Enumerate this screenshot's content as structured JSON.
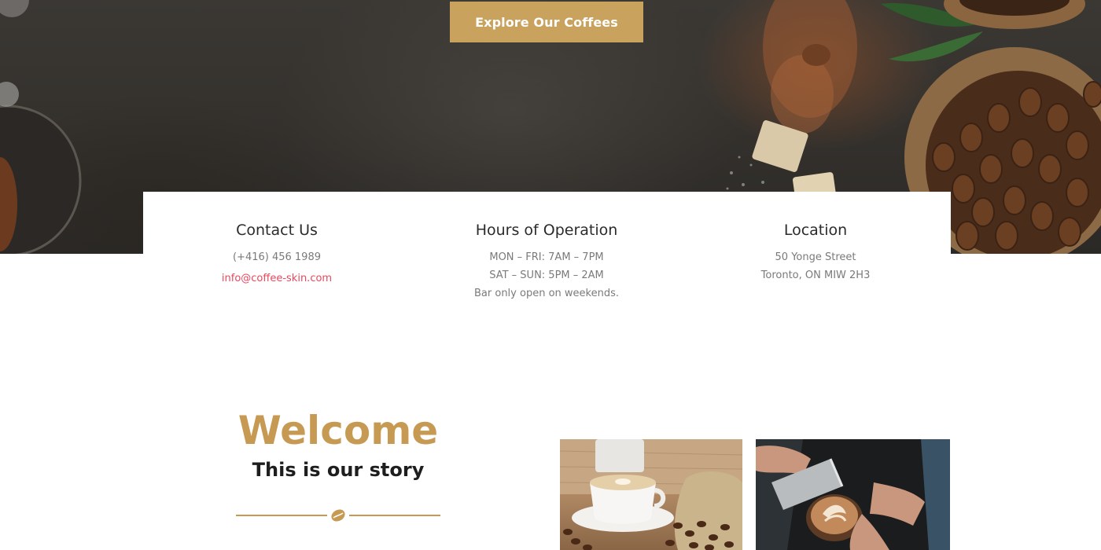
{
  "hero": {
    "cta_label": "Explore Our Coffees"
  },
  "info": {
    "contact": {
      "title": "Contact Us",
      "phone": "(+416) 456 1989",
      "email": "info@coffee-skin.com"
    },
    "hours": {
      "title": "Hours of Operation",
      "line1": "MON – FRI: 7AM – 7PM",
      "line2": "SAT – SUN: 5PM – 2AM",
      "line3": "Bar only open on weekends."
    },
    "location": {
      "title": "Location",
      "line1": "50 Yonge Street",
      "line2": "Toronto, ON MIW 2H3"
    }
  },
  "welcome": {
    "title": "Welcome",
    "subtitle": "This is our story"
  },
  "icons": {
    "divider": "coffee-bean-icon"
  },
  "colors": {
    "accent": "#c9a25e",
    "link": "#e8475c",
    "heading": "#2b2b2b",
    "muted": "#7a7a7a"
  }
}
